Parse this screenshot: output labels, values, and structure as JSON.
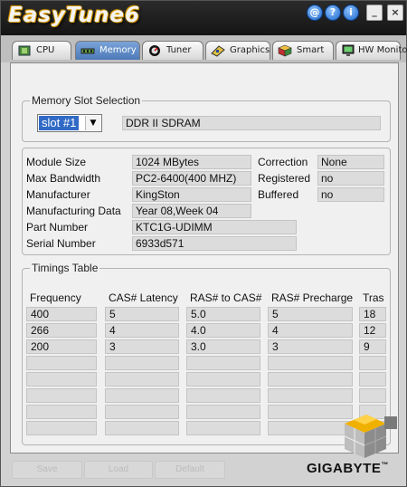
{
  "app": {
    "title": "EasyTune6",
    "title_buttons": [
      "@",
      "?",
      "i",
      "_",
      "×"
    ]
  },
  "tabs": [
    {
      "label": "CPU",
      "icon": "cpu-chip-icon"
    },
    {
      "label": "Memory",
      "icon": "memory-stick-icon",
      "active": true
    },
    {
      "label": "Tuner",
      "icon": "gauge-icon"
    },
    {
      "label": "Graphics",
      "icon": "graphics-card-icon"
    },
    {
      "label": "Smart",
      "icon": "cube-icon"
    },
    {
      "label": "HW Monitor",
      "icon": "monitor-icon"
    }
  ],
  "slot": {
    "legend": "Memory Slot Selection",
    "selected": "slot #1",
    "type": "DDR II SDRAM"
  },
  "info": {
    "module_size_label": "Module Size",
    "module_size": "1024 MBytes",
    "max_bandwidth_label": "Max Bandwidth",
    "max_bandwidth": "PC2-6400(400 MHZ)",
    "manufacturer_label": "Manufacturer",
    "manufacturer": "KingSton",
    "manufacturing_data_label": "Manufacturing Data",
    "manufacturing_data": "Year 08,Week 04",
    "part_number_label": "Part Number",
    "part_number": "KTC1G-UDIMM",
    "serial_number_label": "Serial Number",
    "serial_number": "6933d571",
    "correction_label": "Correction",
    "correction": "None",
    "registered_label": "Registered",
    "registered": "no",
    "buffered_label": "Buffered",
    "buffered": "no"
  },
  "timings": {
    "legend": "Timings Table",
    "headers": [
      "Frequency",
      "CAS# Latency",
      "RAS# to CAS#",
      "RAS# Precharge",
      "Tras"
    ],
    "rows": [
      [
        "400",
        "5",
        "5.0",
        "5",
        "18"
      ],
      [
        "266",
        "4",
        "4.0",
        "4",
        "12"
      ],
      [
        "200",
        "3",
        "3.0",
        "3",
        "9"
      ],
      [
        "",
        "",
        "",
        "",
        ""
      ],
      [
        "",
        "",
        "",
        "",
        ""
      ],
      [
        "",
        "",
        "",
        "",
        ""
      ],
      [
        "",
        "",
        "",
        "",
        ""
      ],
      [
        "",
        "",
        "",
        "",
        ""
      ]
    ]
  },
  "buttons": {
    "save": "Save",
    "load": "Load",
    "default": "Default"
  },
  "brand": "GIGABYTE",
  "brand_suffix": "™"
}
